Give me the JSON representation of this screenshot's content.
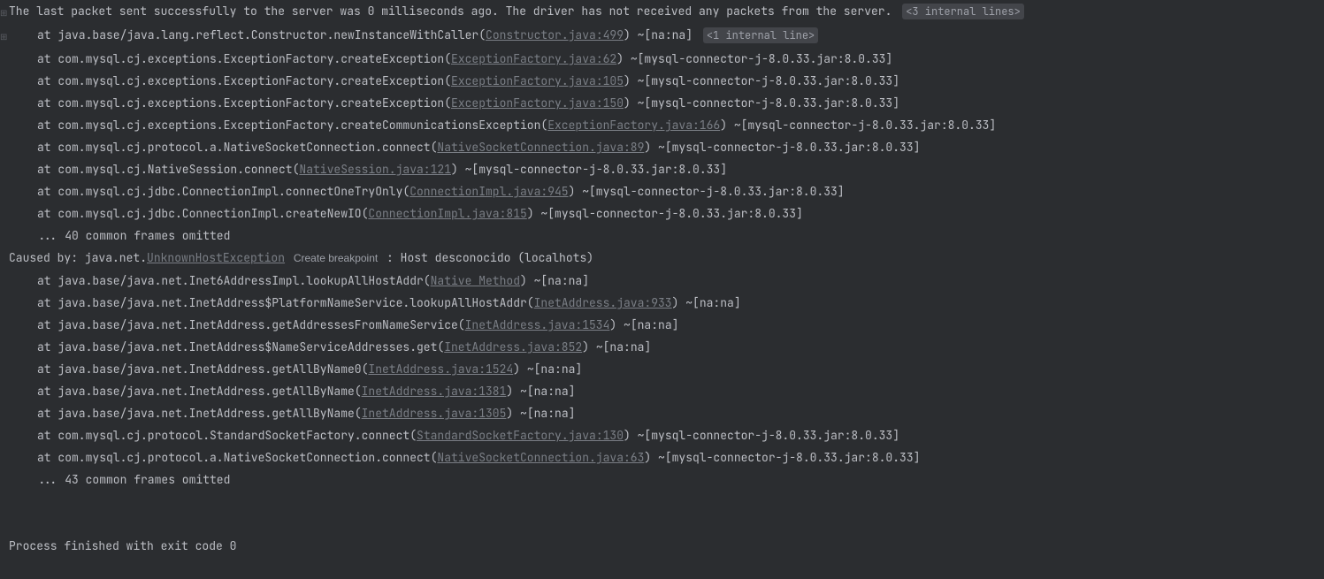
{
  "badges": {
    "internal3": "<3 internal lines>",
    "internal1": "<1 internal line>"
  },
  "createBreakpoint": "Create breakpoint",
  "lines": [
    {
      "gutter": "⊞",
      "pre": "The last packet sent successfully to the server was 0 milliseconds ago. The driver has not received any packets from the server. ",
      "badge": "internal3"
    },
    {
      "gutter": "⊞",
      "indent": true,
      "pre": "at java.base/java.lang.reflect.Constructor.newInstanceWithCaller(",
      "link": "Constructor.java:499",
      "post": ") ~[na:na] ",
      "badge": "internal1"
    },
    {
      "indent": true,
      "pre": "at com.mysql.cj.exceptions.ExceptionFactory.createException(",
      "link": "ExceptionFactory.java:62",
      "post": ") ~[mysql-connector-j-8.0.33.jar:8.0.33]"
    },
    {
      "indent": true,
      "pre": "at com.mysql.cj.exceptions.ExceptionFactory.createException(",
      "link": "ExceptionFactory.java:105",
      "post": ") ~[mysql-connector-j-8.0.33.jar:8.0.33]"
    },
    {
      "indent": true,
      "pre": "at com.mysql.cj.exceptions.ExceptionFactory.createException(",
      "link": "ExceptionFactory.java:150",
      "post": ") ~[mysql-connector-j-8.0.33.jar:8.0.33]"
    },
    {
      "indent": true,
      "pre": "at com.mysql.cj.exceptions.ExceptionFactory.createCommunicationsException(",
      "link": "ExceptionFactory.java:166",
      "post": ") ~[mysql-connector-j-8.0.33.jar:8.0.33]"
    },
    {
      "indent": true,
      "pre": "at com.mysql.cj.protocol.a.NativeSocketConnection.connect(",
      "link": "NativeSocketConnection.java:89",
      "post": ") ~[mysql-connector-j-8.0.33.jar:8.0.33]"
    },
    {
      "indent": true,
      "pre": "at com.mysql.cj.NativeSession.connect(",
      "link": "NativeSession.java:121",
      "post": ") ~[mysql-connector-j-8.0.33.jar:8.0.33]"
    },
    {
      "indent": true,
      "pre": "at com.mysql.cj.jdbc.ConnectionImpl.connectOneTryOnly(",
      "link": "ConnectionImpl.java:945",
      "post": ") ~[mysql-connector-j-8.0.33.jar:8.0.33]"
    },
    {
      "indent": true,
      "pre": "at com.mysql.cj.jdbc.ConnectionImpl.createNewIO(",
      "link": "ConnectionImpl.java:815",
      "post": ") ~[mysql-connector-j-8.0.33.jar:8.0.33]"
    },
    {
      "indent": true,
      "pre": "... 40 common frames omitted"
    },
    {
      "pre": "Caused by: java.net.",
      "link": "UnknownHostException",
      "breakpoint": true,
      "post": ": Host desconocido (localhots)"
    },
    {
      "indent": true,
      "pre": "at java.base/java.net.Inet6AddressImpl.lookupAllHostAddr(",
      "link": "Native Method",
      "post": ") ~[na:na]"
    },
    {
      "indent": true,
      "pre": "at java.base/java.net.InetAddress$PlatformNameService.lookupAllHostAddr(",
      "link": "InetAddress.java:933",
      "post": ") ~[na:na]"
    },
    {
      "indent": true,
      "pre": "at java.base/java.net.InetAddress.getAddressesFromNameService(",
      "link": "InetAddress.java:1534",
      "post": ") ~[na:na]"
    },
    {
      "indent": true,
      "pre": "at java.base/java.net.InetAddress$NameServiceAddresses.get(",
      "link": "InetAddress.java:852",
      "post": ") ~[na:na]"
    },
    {
      "indent": true,
      "pre": "at java.base/java.net.InetAddress.getAllByName0(",
      "link": "InetAddress.java:1524",
      "post": ") ~[na:na]"
    },
    {
      "indent": true,
      "pre": "at java.base/java.net.InetAddress.getAllByName(",
      "link": "InetAddress.java:1381",
      "post": ") ~[na:na]"
    },
    {
      "indent": true,
      "pre": "at java.base/java.net.InetAddress.getAllByName(",
      "link": "InetAddress.java:1305",
      "post": ") ~[na:na]"
    },
    {
      "indent": true,
      "pre": "at com.mysql.cj.protocol.StandardSocketFactory.connect(",
      "link": "StandardSocketFactory.java:130",
      "post": ") ~[mysql-connector-j-8.0.33.jar:8.0.33]"
    },
    {
      "indent": true,
      "pre": "at com.mysql.cj.protocol.a.NativeSocketConnection.connect(",
      "link": "NativeSocketConnection.java:63",
      "post": ") ~[mysql-connector-j-8.0.33.jar:8.0.33]"
    },
    {
      "indent": true,
      "pre": "... 43 common frames omitted"
    }
  ],
  "exitLine": "Process finished with exit code 0"
}
